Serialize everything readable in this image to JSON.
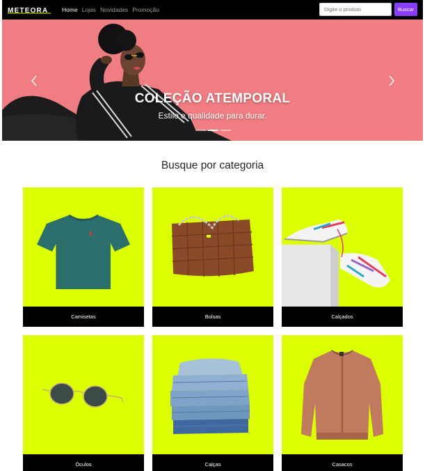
{
  "navbar": {
    "brand": "METEORA",
    "links": [
      "Home",
      "Lojas",
      "Novidades",
      "Promoção"
    ],
    "active_link": "Home",
    "search": {
      "placeholder": "Digite o produto",
      "value": "",
      "button_label": "Buscar"
    },
    "colors": {
      "background": "#000000",
      "button": "#8b3dff"
    }
  },
  "hero": {
    "title": "COLEÇÃO ATEMPORAL",
    "subtitle": "Estilo e qualidade para durar.",
    "background_color": "#f07d82",
    "slides_total": 3,
    "active_slide": 2
  },
  "categories": {
    "title": "Busque por categoria",
    "card_color": "#dbff00",
    "items": [
      {
        "label": "Camisetas",
        "icon": "tshirt-image"
      },
      {
        "label": "Bolsas",
        "icon": "handbag-image"
      },
      {
        "label": "Calçados",
        "icon": "sneakers-image"
      },
      {
        "label": "Óculos",
        "icon": "sunglasses-image"
      },
      {
        "label": "Calças",
        "icon": "jeans-stack-image"
      },
      {
        "label": "Casacos",
        "icon": "jacket-image"
      }
    ]
  }
}
